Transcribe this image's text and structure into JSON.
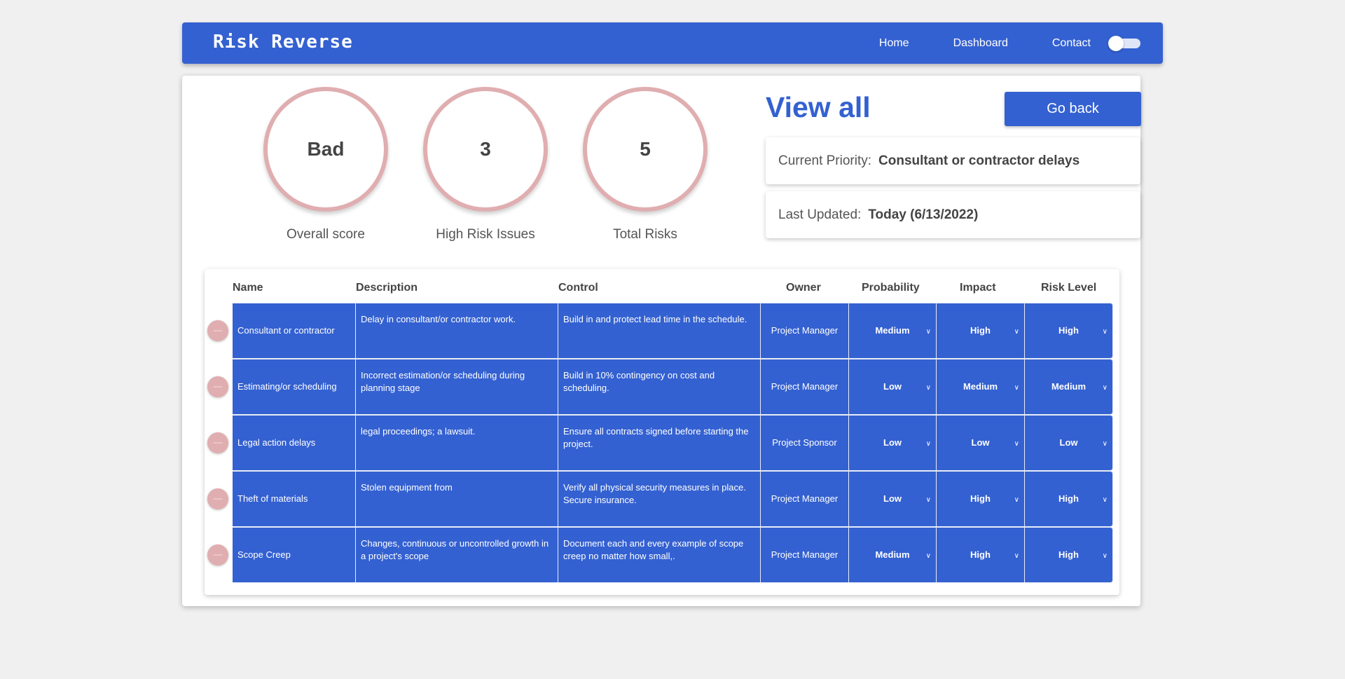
{
  "nav": {
    "logo": "Risk Reverse",
    "links": [
      "Home",
      "Dashboard",
      "Contact"
    ]
  },
  "stats": [
    {
      "value": "Bad",
      "label": "Overall score"
    },
    {
      "value": "3",
      "label": "High Risk Issues"
    },
    {
      "value": "5",
      "label": "Total Risks"
    }
  ],
  "header": {
    "title": "View all",
    "back_label": "Go back"
  },
  "priority": {
    "label": "Current Priority:",
    "value": "Consultant or contractor delays"
  },
  "updated": {
    "label": "Last Updated:",
    "value": "Today (6/13/2022)"
  },
  "table": {
    "columns": [
      "Name",
      "Description",
      "Control",
      "Owner",
      "Probability",
      "Impact",
      "Risk Level"
    ],
    "rows": [
      {
        "name": "Consultant or contractor",
        "description": "Delay in consultant/or contractor work.",
        "control": "Build in and protect lead time in the schedule.",
        "owner": "Project Manager",
        "probability": "Medium",
        "impact": "High",
        "risk": "High"
      },
      {
        "name": "Estimating/or scheduling",
        "description": "Incorrect estimation/or scheduling during planning stage",
        "control": "Build in 10% contingency on cost and scheduling.",
        "owner": "Project Manager",
        "probability": "Low",
        "impact": "Medium",
        "risk": "Medium"
      },
      {
        "name": "Legal action delays",
        "description": "legal proceedings; a lawsuit.",
        "control": "Ensure all contracts signed before starting the project.",
        "owner": "Project Sponsor",
        "probability": "Low",
        "impact": "Low",
        "risk": "Low"
      },
      {
        "name": "Theft of materials",
        "description": "Stolen equipment from",
        "control": "Verify all physical security measures in place. Secure insurance.",
        "owner": "Project Manager",
        "probability": "Low",
        "impact": "High",
        "risk": "High"
      },
      {
        "name": "Scope Creep",
        "description": "Changes, continuous or uncontrolled growth in a project's scope",
        "control": "Document each and every example of scope creep no matter how small,.",
        "owner": "Project Manager",
        "probability": "Medium",
        "impact": "High",
        "risk": "High"
      }
    ]
  }
}
